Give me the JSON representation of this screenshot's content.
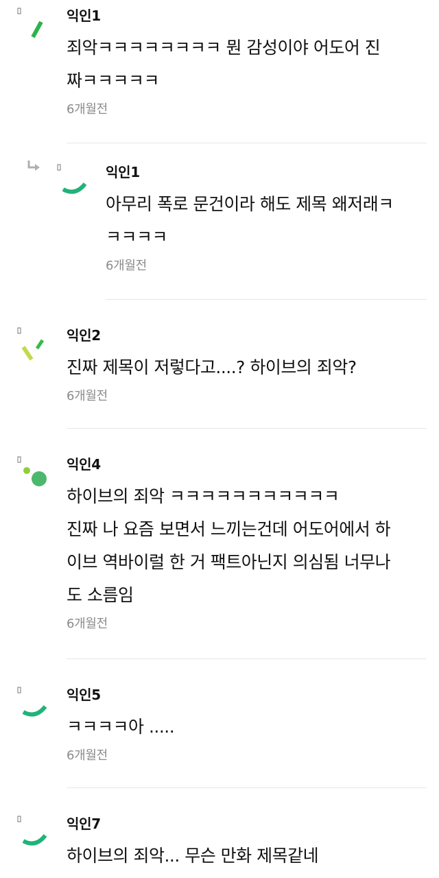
{
  "comments": [
    {
      "author": "익인1",
      "lines": [
        "죄악ㅋㅋㅋㅋㅋㅋㅋㅋ 뭔 감성이야 어도어 진",
        "짜ㅋㅋㅋㅋㅋ"
      ],
      "time": "6개월전",
      "avatar_icon": "green-stroke-avatar-icon",
      "avatar_colors": [
        "#2db34a"
      ]
    },
    {
      "author": "익인1",
      "lines": [
        "아무리 폭로 문건이라 해도 제목 왜저래ㅋ",
        "ㅋㅋㅋㅋ"
      ],
      "time": "6개월전",
      "is_reply": true,
      "reply_icon": "reply-arrow-icon",
      "avatar_icon": "teal-arc-avatar-icon",
      "avatar_colors": [
        "#1fb37a"
      ]
    },
    {
      "author": "익인2",
      "lines": [
        "진짜 제목이 저렇다고....? 하이브의 죄악?"
      ],
      "time": "6개월전",
      "avatar_icon": "lime-strokes-avatar-icon",
      "avatar_colors": [
        "#c3d94a",
        "#3cb84a"
      ]
    },
    {
      "author": "익인4",
      "lines": [
        "하이브의 죄악 ㅋㅋㅋㅋㅋㅋㅋㅋㅋㅋㅋ",
        "진짜 나 요즘 보면서 느끼는건데 어도어에서 하",
        "이브 역바이럴 한 거 팩트아닌지 의심됨 너무나",
        "도 소름임"
      ],
      "time": "6개월전",
      "avatar_icon": "green-dots-avatar-icon",
      "avatar_colors": [
        "#8fce3a",
        "#4cb86e"
      ]
    },
    {
      "author": "익인5",
      "lines": [
        "ㅋㅋㅋㅋ아 ....."
      ],
      "time": "6개월전",
      "avatar_icon": "teal-arc-avatar-icon",
      "avatar_colors": [
        "#1fb37a"
      ]
    },
    {
      "author": "익인7",
      "lines": [
        "하이브의 죄악... 무슨 만화 제목같네"
      ],
      "time": "",
      "avatar_icon": "teal-arc-avatar-icon",
      "avatar_colors": [
        "#1fb37a"
      ]
    }
  ]
}
